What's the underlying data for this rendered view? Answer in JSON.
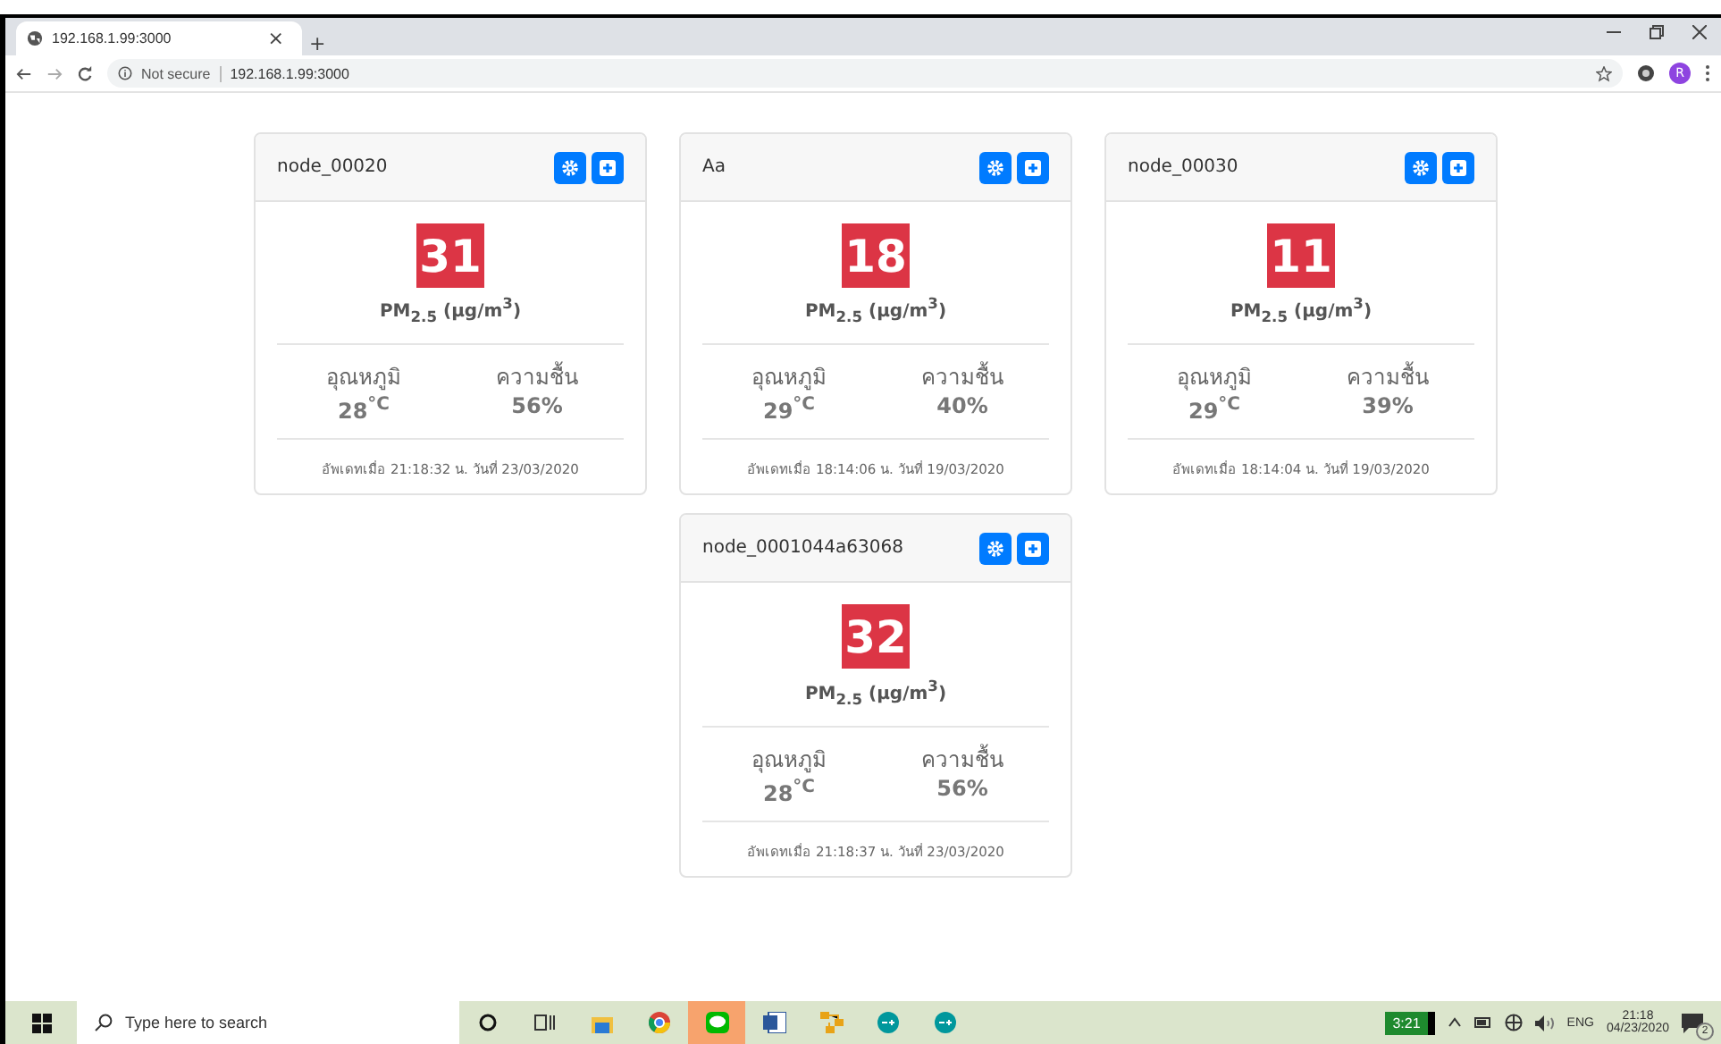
{
  "browser": {
    "tab_title": "192.168.1.99:3000",
    "tab_close": "×",
    "new_tab": "+",
    "security": "Not secure",
    "url": "192.168.1.99:3000",
    "profile_initial": "R"
  },
  "cards": [
    {
      "name": "node_00020",
      "pm": "31",
      "pm_label": "PM$_{2.5}$ (µg/m$^{3}$)",
      "temp_label": "อุณหภูมิ",
      "temp_value": "28$^{°C}$",
      "humidity_label": "ความชื้น",
      "humidity_value": "56%",
      "updated": "อัพเดทเมื่อ 21:18:32 น. วันที่ 23/03/2020"
    },
    {
      "name": "Aa",
      "pm": "18",
      "pm_label": "PM$_{2.5}$ (µg/m$^{3}$)",
      "temp_label": "อุณหภูมิ",
      "temp_value": "29$^{°C}$",
      "humidity_label": "ความชื้น",
      "humidity_value": "40%",
      "updated": "อัพเดทเมื่อ 18:14:06 น. วันที่ 19/03/2020"
    },
    {
      "name": "node_00030",
      "pm": "11",
      "pm_label": "PM$_{2.5}$ (µg/m$^{3}$)",
      "temp_label": "อุณหภูมิ",
      "temp_value": "29$^{°C}$",
      "humidity_label": "ความชื้น",
      "humidity_value": "39%",
      "updated": "อัพเดทเมื่อ 18:14:04 น. วันที่ 19/03/2020"
    },
    {
      "name": "node_0001044a63068",
      "pm": "32",
      "pm_label": "PM$_{2.5}$ (µg/m$^{3}$)",
      "temp_label": "อุณหภูมิ",
      "temp_value": "28$^{°C}$",
      "humidity_label": "ความชื้น",
      "humidity_value": "56%",
      "updated": "อัพเดทเมื่อ 21:18:37 น. วันที่ 23/03/2020"
    }
  ],
  "taskbar": {
    "search_placeholder": "Type here to search",
    "battery_time": "3:21",
    "language": "ENG",
    "time": "21:18",
    "date": "04/23/2020",
    "notifications": "2"
  }
}
